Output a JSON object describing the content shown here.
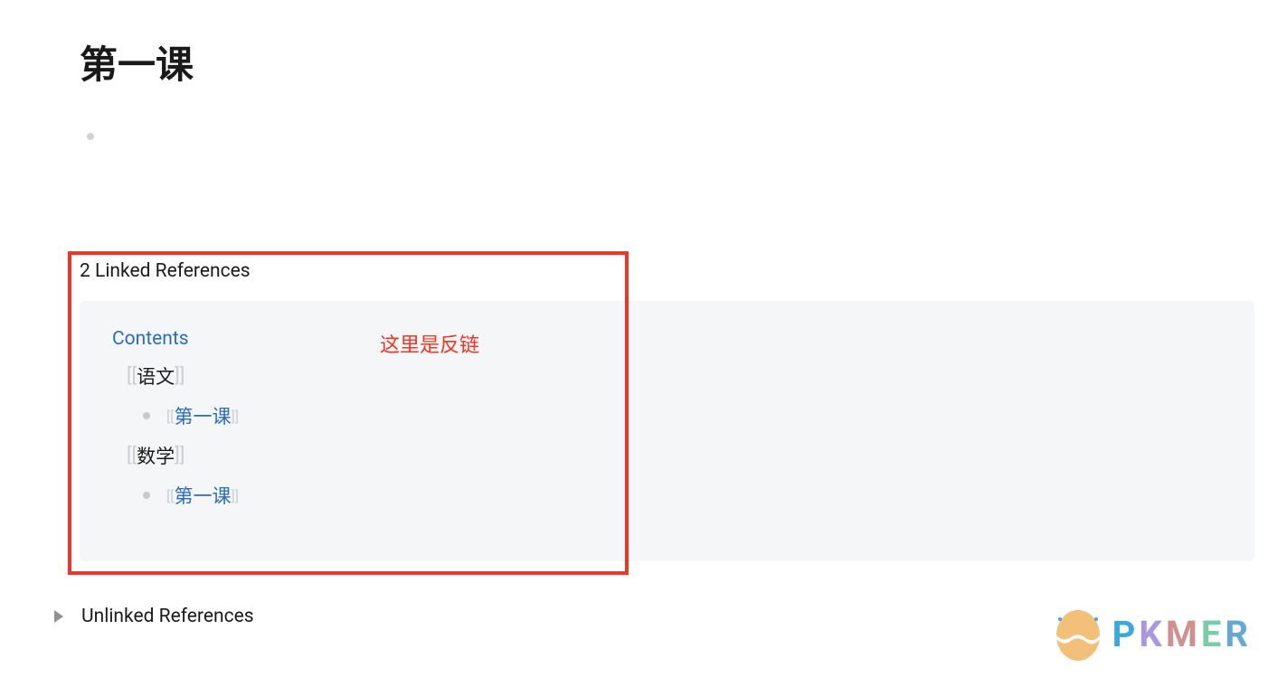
{
  "page": {
    "title": "第一课"
  },
  "linkedReferences": {
    "heading": "2 Linked References",
    "contentsLabel": "Contents",
    "annotation": "这里是反链",
    "subjects": [
      {
        "name": "语文",
        "link": "第一课"
      },
      {
        "name": "数学",
        "link": "第一课"
      }
    ]
  },
  "unlinkedReferences": {
    "label": "Unlinked References"
  },
  "watermark": {
    "brand": "PKMER"
  }
}
